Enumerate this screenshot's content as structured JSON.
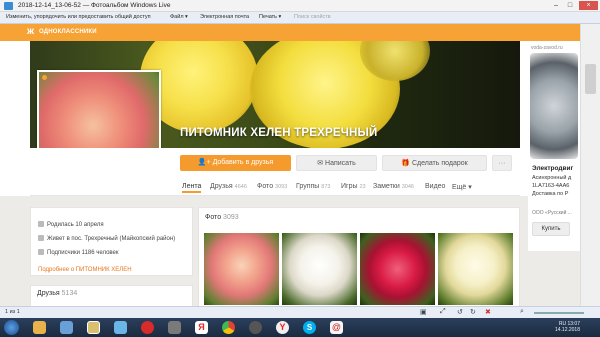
{
  "window": {
    "title": "2018-12-14_13-06-52 — Фотоальбом Windows Live",
    "min": "–",
    "max": "□",
    "close": "×"
  },
  "menubar": {
    "items": [
      "Изменить, упорядочить или предоставить общий доступ",
      "Файл ▾",
      "Электронная почта",
      "Печать ▾",
      "Поиск свойств"
    ]
  },
  "site": {
    "logo": "ж",
    "name": "ОДНОКЛАССНИКИ"
  },
  "profile": {
    "name": "ПИТОМНИК ХЕЛЕН ТРЕХРЕЧНЫЙ"
  },
  "actions": {
    "add_friend": "Добавить в друзья",
    "write": "Написать",
    "gift": "Сделать подарок",
    "more": "···"
  },
  "tabs": [
    {
      "label": "Лента",
      "count": ""
    },
    {
      "label": "Друзья",
      "count": "4646"
    },
    {
      "label": "Фото",
      "count": "3093"
    },
    {
      "label": "Группы",
      "count": "873"
    },
    {
      "label": "Игры",
      "count": "23"
    },
    {
      "label": "Заметки",
      "count": "3046"
    },
    {
      "label": "Видео",
      "count": ""
    },
    {
      "label": "Ещё ▾",
      "count": ""
    }
  ],
  "info": {
    "birthday": "Родилась 10 апреля",
    "location": "Живет в пос. Трехречный (Майкопский район)",
    "subscribers": "Подписчики 1186 человек",
    "more_link": "Подробнее о ПИТОМНИК ХЕЛЕН"
  },
  "friends": {
    "label": "Друзья",
    "count": "5134"
  },
  "photos": {
    "label": "Фото",
    "count": "3093"
  },
  "ad": {
    "brand": "voda-zavod.ru",
    "title": "Электродвиг",
    "line1": "Асинхронный д",
    "line2": "1LA7163-4AA6",
    "line3": "Доставка по Р",
    "small": "ООО «Русский ...",
    "button": "Купить"
  },
  "statusbar": {
    "left": "1 из 1"
  },
  "tray": {
    "lang": "RU",
    "time": "13:07",
    "date": "14.12.2018"
  },
  "colors": {
    "accent": "#f59a2d",
    "header": "#f7a234",
    "link": "#e8761d"
  }
}
